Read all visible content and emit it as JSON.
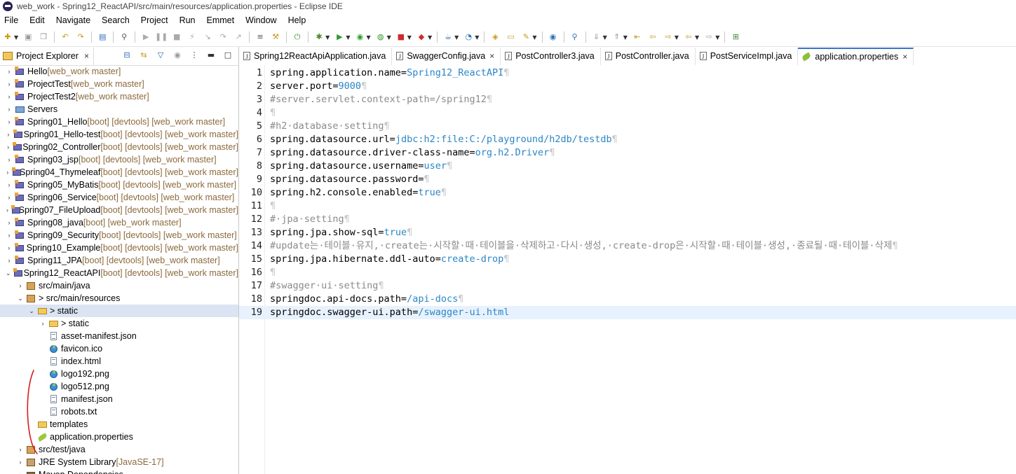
{
  "window": {
    "title": "web_work - Spring12_ReactAPI/src/main/resources/application.properties - Eclipse IDE"
  },
  "menu": [
    "File",
    "Edit",
    "Navigate",
    "Search",
    "Project",
    "Run",
    "Emmet",
    "Window",
    "Help"
  ],
  "left_panel": {
    "tab_label": "Project Explorer",
    "close": "×"
  },
  "tree": [
    {
      "chev": "›",
      "icon": "project-icon",
      "label": "Hello",
      "deco": " [web_work master]",
      "indent": 0
    },
    {
      "chev": "›",
      "icon": "project-icon",
      "label": "ProjectTest",
      "deco": " [web_work master]",
      "indent": 0
    },
    {
      "chev": "›",
      "icon": "project-icon",
      "label": "ProjectTest2",
      "deco": " [web_work master]",
      "indent": 0
    },
    {
      "chev": "›",
      "icon": "servers-icon",
      "label": "Servers",
      "deco": "",
      "indent": 0
    },
    {
      "chev": "›",
      "icon": "project-icon",
      "label": "Spring01_Hello",
      "deco": " [boot] [devtools] [web_work master]",
      "indent": 0
    },
    {
      "chev": "›",
      "icon": "project-icon",
      "label": "Spring01_Hello-test",
      "deco": " [boot] [devtools] [web_work master]",
      "indent": 0
    },
    {
      "chev": "›",
      "icon": "project-icon",
      "label": "Spring02_Controller",
      "deco": " [boot] [devtools] [web_work master]",
      "indent": 0
    },
    {
      "chev": "›",
      "icon": "project-icon",
      "label": "Spring03_jsp",
      "deco": " [boot] [devtools] [web_work master]",
      "indent": 0
    },
    {
      "chev": "›",
      "icon": "project-icon",
      "label": "Spring04_Thymeleaf",
      "deco": " [boot] [devtools] [web_work master]",
      "indent": 0
    },
    {
      "chev": "›",
      "icon": "project-icon",
      "label": "Spring05_MyBatis",
      "deco": " [boot] [devtools] [web_work master]",
      "indent": 0
    },
    {
      "chev": "›",
      "icon": "project-icon",
      "label": "Spring06_Service",
      "deco": " [boot] [devtools] [web_work master]",
      "indent": 0
    },
    {
      "chev": "›",
      "icon": "project-icon",
      "label": "Spring07_FileUpload",
      "deco": " [boot] [devtools] [web_work master]",
      "indent": 0
    },
    {
      "chev": "›",
      "icon": "project-icon",
      "label": "Spring08_java",
      "deco": " [boot] [web_work master]",
      "indent": 0
    },
    {
      "chev": "›",
      "icon": "project-icon",
      "label": "Spring09_Security",
      "deco": " [boot] [devtools] [web_work master]",
      "indent": 0
    },
    {
      "chev": "›",
      "icon": "project-icon",
      "label": "Spring10_Example",
      "deco": " [boot] [devtools] [web_work master]",
      "indent": 0
    },
    {
      "chev": "›",
      "icon": "project-icon",
      "label": "Spring11_JPA",
      "deco": " [boot] [devtools] [web_work master]",
      "indent": 0
    },
    {
      "chev": "⌄",
      "icon": "project-icon",
      "label": "> Spring12_ReactAPI",
      "deco": " [boot] [devtools] [web_work master]",
      "indent": 0
    },
    {
      "chev": "›",
      "icon": "package-icon",
      "label": "src/main/java",
      "deco": "",
      "indent": 1
    },
    {
      "chev": "⌄",
      "icon": "package-icon",
      "label": "> src/main/resources",
      "deco": "",
      "indent": 1
    },
    {
      "chev": "⌄",
      "icon": "folder-icon",
      "label": "> static",
      "deco": "",
      "indent": 2,
      "selected": true
    },
    {
      "chev": "›",
      "icon": "folder-icon",
      "label": "> static",
      "deco": "",
      "indent": 3
    },
    {
      "chev": "",
      "icon": "file-icon",
      "label": "asset-manifest.json",
      "deco": "",
      "indent": 3
    },
    {
      "chev": "",
      "icon": "web-icon",
      "label": "favicon.ico",
      "deco": "",
      "indent": 3
    },
    {
      "chev": "",
      "icon": "file-icon",
      "label": "index.html",
      "deco": "",
      "indent": 3
    },
    {
      "chev": "",
      "icon": "web-icon",
      "label": "logo192.png",
      "deco": "",
      "indent": 3
    },
    {
      "chev": "",
      "icon": "web-icon",
      "label": "logo512.png",
      "deco": "",
      "indent": 3
    },
    {
      "chev": "",
      "icon": "file-icon",
      "label": "manifest.json",
      "deco": "",
      "indent": 3
    },
    {
      "chev": "",
      "icon": "file-icon",
      "label": "robots.txt",
      "deco": "",
      "indent": 3
    },
    {
      "chev": "",
      "icon": "folder-icon",
      "label": "templates",
      "deco": "",
      "indent": 2
    },
    {
      "chev": "",
      "icon": "properties-icon",
      "label": "application.properties",
      "deco": "",
      "indent": 2
    },
    {
      "chev": "›",
      "icon": "package-icon",
      "label": "src/test/java",
      "deco": "",
      "indent": 1
    },
    {
      "chev": "›",
      "icon": "jre-icon",
      "label": "JRE System Library",
      "deco": " [JavaSE-17]",
      "indent": 1
    },
    {
      "chev": "›",
      "icon": "library-icon",
      "label": "Maven Dependencies",
      "deco": "",
      "indent": 1
    }
  ],
  "editor_tabs": [
    {
      "label": "Spring12ReactApiApplication.java",
      "icon": "java-file-icon",
      "active": false,
      "close": ""
    },
    {
      "label": "SwaggerConfig.java",
      "icon": "java-file-icon",
      "active": false,
      "close": "×"
    },
    {
      "label": "PostController3.java",
      "icon": "java-file-icon",
      "active": false,
      "close": ""
    },
    {
      "label": "PostController.java",
      "icon": "java-file-icon",
      "active": false,
      "close": ""
    },
    {
      "label": "PostServiceImpl.java",
      "icon": "java-file-icon",
      "active": false,
      "close": ""
    },
    {
      "label": "application.properties",
      "icon": "properties-file-icon",
      "active": true,
      "close": "×"
    }
  ],
  "editor": {
    "pilcrow": "¶",
    "lines": [
      {
        "n": "1",
        "key": "spring.application.name=",
        "val": "Spring12_ReactAPI",
        "comment": ""
      },
      {
        "n": "2",
        "key": "server.port=",
        "val": "9000",
        "comment": ""
      },
      {
        "n": "3",
        "key": "",
        "val": "",
        "comment": "#server.servlet.context-path=/spring12"
      },
      {
        "n": "4",
        "key": "",
        "val": "",
        "comment": ""
      },
      {
        "n": "5",
        "key": "",
        "val": "",
        "comment": "#h2·database·setting"
      },
      {
        "n": "6",
        "key": "spring.datasource.url=",
        "val": "jdbc:h2:file:C:/playground/h2db/testdb",
        "comment": ""
      },
      {
        "n": "7",
        "key": "spring.datasource.driver-class-name=",
        "val": "org.h2.Driver",
        "comment": ""
      },
      {
        "n": "8",
        "key": "spring.datasource.username=",
        "val": "user",
        "comment": ""
      },
      {
        "n": "9",
        "key": "spring.datasource.password=",
        "val": "",
        "comment": ""
      },
      {
        "n": "10",
        "key": "spring.h2.console.enabled=",
        "val": "true",
        "comment": ""
      },
      {
        "n": "11",
        "key": "",
        "val": "",
        "comment": ""
      },
      {
        "n": "12",
        "key": "",
        "val": "",
        "comment": "#·jpa·setting"
      },
      {
        "n": "13",
        "key": "spring.jpa.show-sql=",
        "val": "true",
        "comment": ""
      },
      {
        "n": "14",
        "key": "",
        "val": "",
        "comment": "#update는·테이블·유지,·create는·시작할·때·테이블을·삭제하고·다시·생성,·create-drop은·시작할·때·테이블·생성,·종료될·때·테이블·삭제"
      },
      {
        "n": "15",
        "key": "spring.jpa.hibernate.ddl-auto=",
        "val": "create-drop",
        "comment": ""
      },
      {
        "n": "16",
        "key": "",
        "val": "",
        "comment": ""
      },
      {
        "n": "17",
        "key": "",
        "val": "",
        "comment": "#swagger·ui·setting"
      },
      {
        "n": "18",
        "key": "springdoc.api-docs.path=",
        "val": "/api-docs",
        "comment": ""
      },
      {
        "n": "19",
        "key": "springdoc.swagger-ui.path=",
        "val": "/swagger-ui.html",
        "comment": "",
        "current": true
      }
    ]
  }
}
